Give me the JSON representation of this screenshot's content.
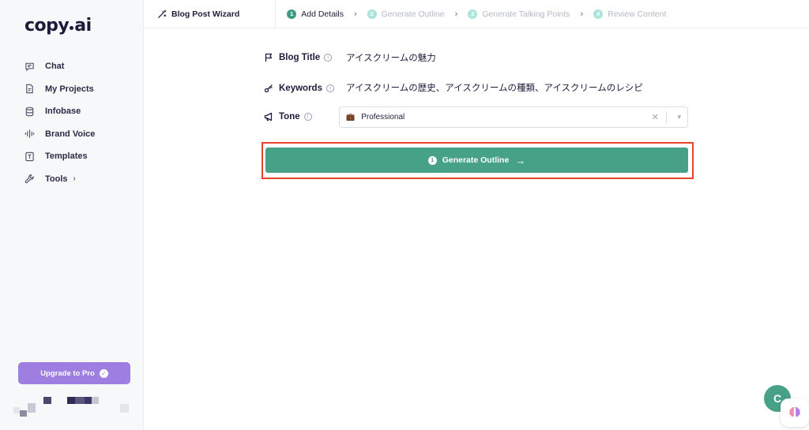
{
  "brand": {
    "logo_left": "copy",
    "logo_right": "ai"
  },
  "sidebar": {
    "items": [
      {
        "label": "Chat",
        "icon": "chat-icon"
      },
      {
        "label": "My Projects",
        "icon": "document-icon"
      },
      {
        "label": "Infobase",
        "icon": "database-icon"
      },
      {
        "label": "Brand Voice",
        "icon": "soundwave-icon"
      },
      {
        "label": "Templates",
        "icon": "template-icon"
      },
      {
        "label": "Tools",
        "icon": "wrench-icon",
        "chevron": "›"
      }
    ],
    "upgrade_label": "Upgrade to Pro"
  },
  "topbar": {
    "wizard_title": "Blog Post Wizard",
    "steps": [
      {
        "num": "1",
        "label": "Add Details",
        "active": true
      },
      {
        "num": "2",
        "label": "Generate Outline",
        "active": false
      },
      {
        "num": "3",
        "label": "Generate Talking Points",
        "active": false
      },
      {
        "num": "4",
        "label": "Review Content",
        "active": false
      }
    ],
    "separator": "›"
  },
  "form": {
    "title_label": "Blog Title",
    "title_value": "アイスクリームの魅力",
    "keywords_label": "Keywords",
    "keywords_value": "アイスクリームの歴史、アイスクリームの種類、アイスクリームのレシピ",
    "tone_label": "Tone",
    "tone_value": "Professional",
    "tone_emoji": "💼",
    "info_glyph": "i"
  },
  "generate_button": {
    "num": "1",
    "label": "Generate Outline",
    "arrow": "→"
  },
  "floating": {
    "chat_letter": "C"
  },
  "colors": {
    "accent": "#47a187",
    "upgrade": "#9e7ee0",
    "highlight": "#e8452c",
    "text": "#1f1d3d"
  }
}
